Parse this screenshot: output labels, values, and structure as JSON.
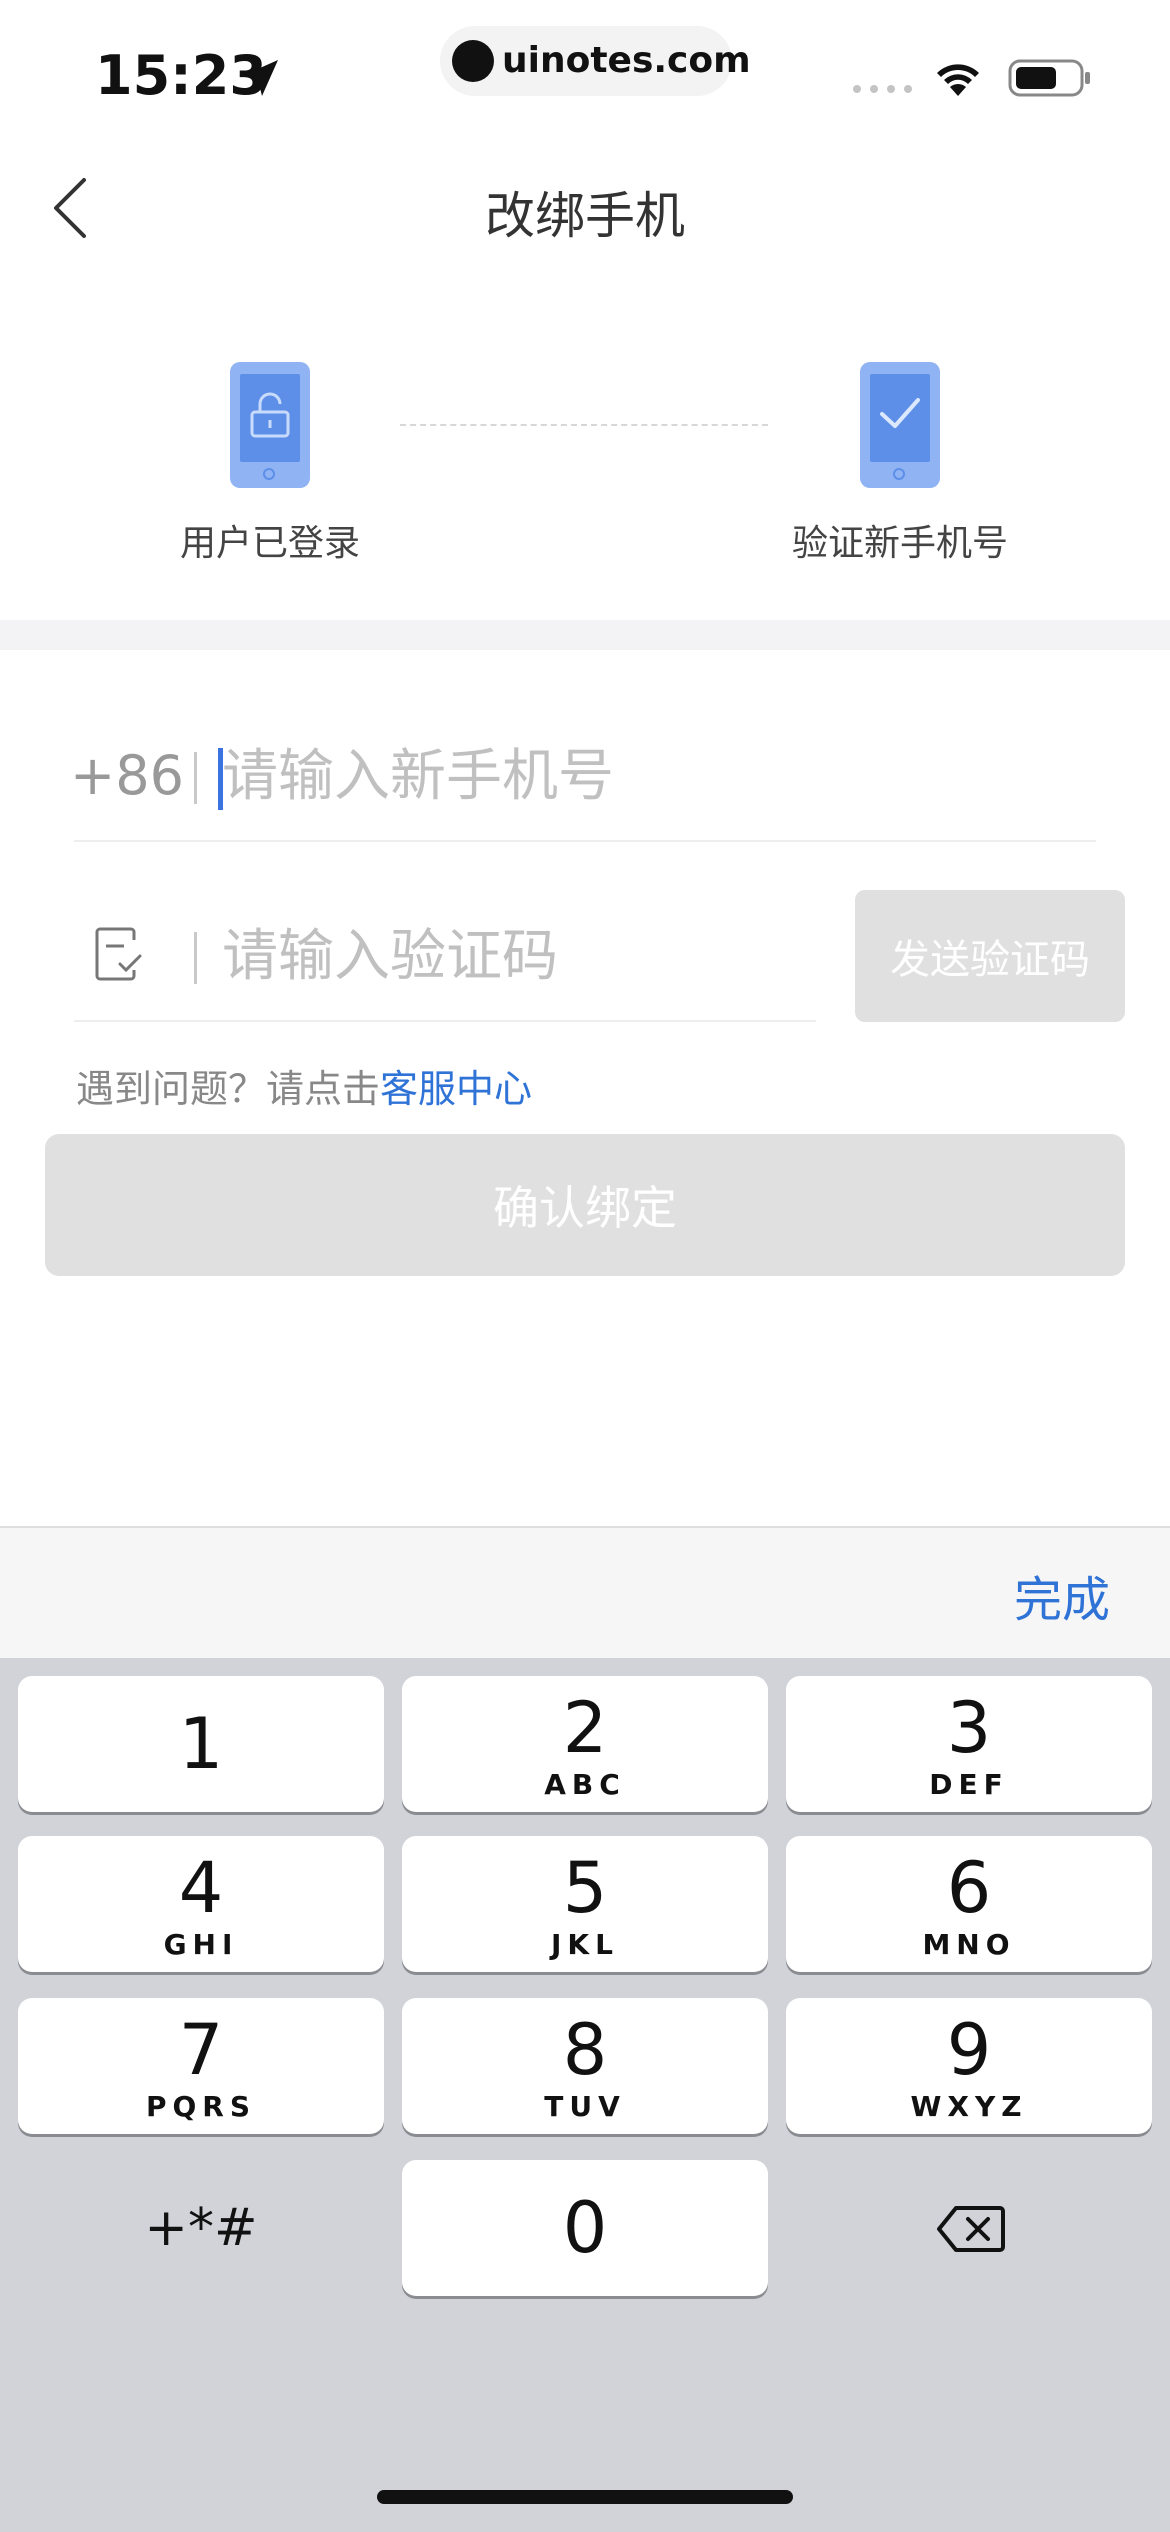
{
  "status_bar": {
    "time": "15:23",
    "url": "uinotes.com"
  },
  "header": {
    "title": "改绑手机"
  },
  "steps": [
    {
      "label": "用户已登录"
    },
    {
      "label": "验证新手机号"
    }
  ],
  "form": {
    "country_code": "+86",
    "phone_placeholder": "请输入新手机号",
    "code_placeholder": "请输入验证码",
    "send_code_label": "发送验证码",
    "help_text": "遇到问题？请点击",
    "help_link": "客服中心",
    "confirm_label": "确认绑定"
  },
  "keyboard": {
    "done_label": "完成",
    "keys": [
      {
        "num": "1",
        "letters": ""
      },
      {
        "num": "2",
        "letters": "ABC"
      },
      {
        "num": "3",
        "letters": "DEF"
      },
      {
        "num": "4",
        "letters": "GHI"
      },
      {
        "num": "5",
        "letters": "JKL"
      },
      {
        "num": "6",
        "letters": "MNO"
      },
      {
        "num": "7",
        "letters": "PQRS"
      },
      {
        "num": "8",
        "letters": "TUV"
      },
      {
        "num": "9",
        "letters": "WXYZ"
      },
      {
        "num": "0",
        "letters": ""
      }
    ],
    "symbols_label": "+*#"
  },
  "colors": {
    "accent": "#2f73d7",
    "step_icon": "#5d8fe8",
    "disabled": "#e0e0e0"
  }
}
